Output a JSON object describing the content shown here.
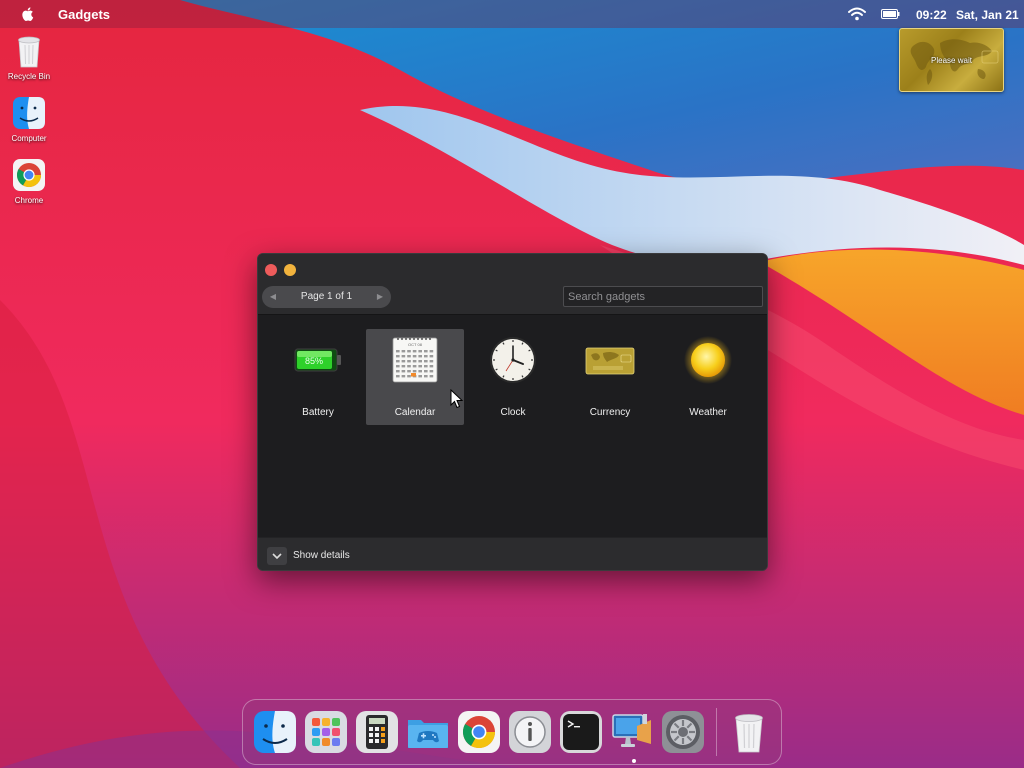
{
  "menubar": {
    "app_title": "Gadgets",
    "time": "09:22",
    "date": "Sat, Jan 21"
  },
  "desktop_widget": {
    "status_text": "Please wait"
  },
  "desktop_icons": [
    {
      "label": "Recycle Bin",
      "icon": "recycle-bin-icon"
    },
    {
      "label": "Computer",
      "icon": "finder-icon"
    },
    {
      "label": "Chrome",
      "icon": "chrome-icon"
    }
  ],
  "gadgets_window": {
    "pager_label": "Page 1 of 1",
    "search_placeholder": "Search gadgets",
    "gadgets": [
      {
        "name": "Battery",
        "icon": "battery-gadget-icon",
        "selected": false,
        "battery_text": "85%"
      },
      {
        "name": "Calendar",
        "icon": "calendar-gadget-icon",
        "selected": true,
        "calendar_header": "OCT 08"
      },
      {
        "name": "Clock",
        "icon": "clock-gadget-icon",
        "selected": false
      },
      {
        "name": "Currency",
        "icon": "currency-gadget-icon",
        "selected": false
      },
      {
        "name": "Weather",
        "icon": "weather-gadget-icon",
        "selected": false
      }
    ],
    "footer_label": "Show details"
  },
  "dock": [
    "finder-icon",
    "launchpad-icon",
    "calculator-icon",
    "games-folder-icon",
    "chrome-icon",
    "info-icon",
    "terminal-icon",
    "screen-sharing-icon",
    "system-preferences-icon",
    "trash-icon"
  ],
  "colors": {
    "window_bg": "#1d1d1f",
    "selected_bg": "#49494c",
    "close": "#ee5b5b",
    "minimize": "#f2b33d"
  }
}
